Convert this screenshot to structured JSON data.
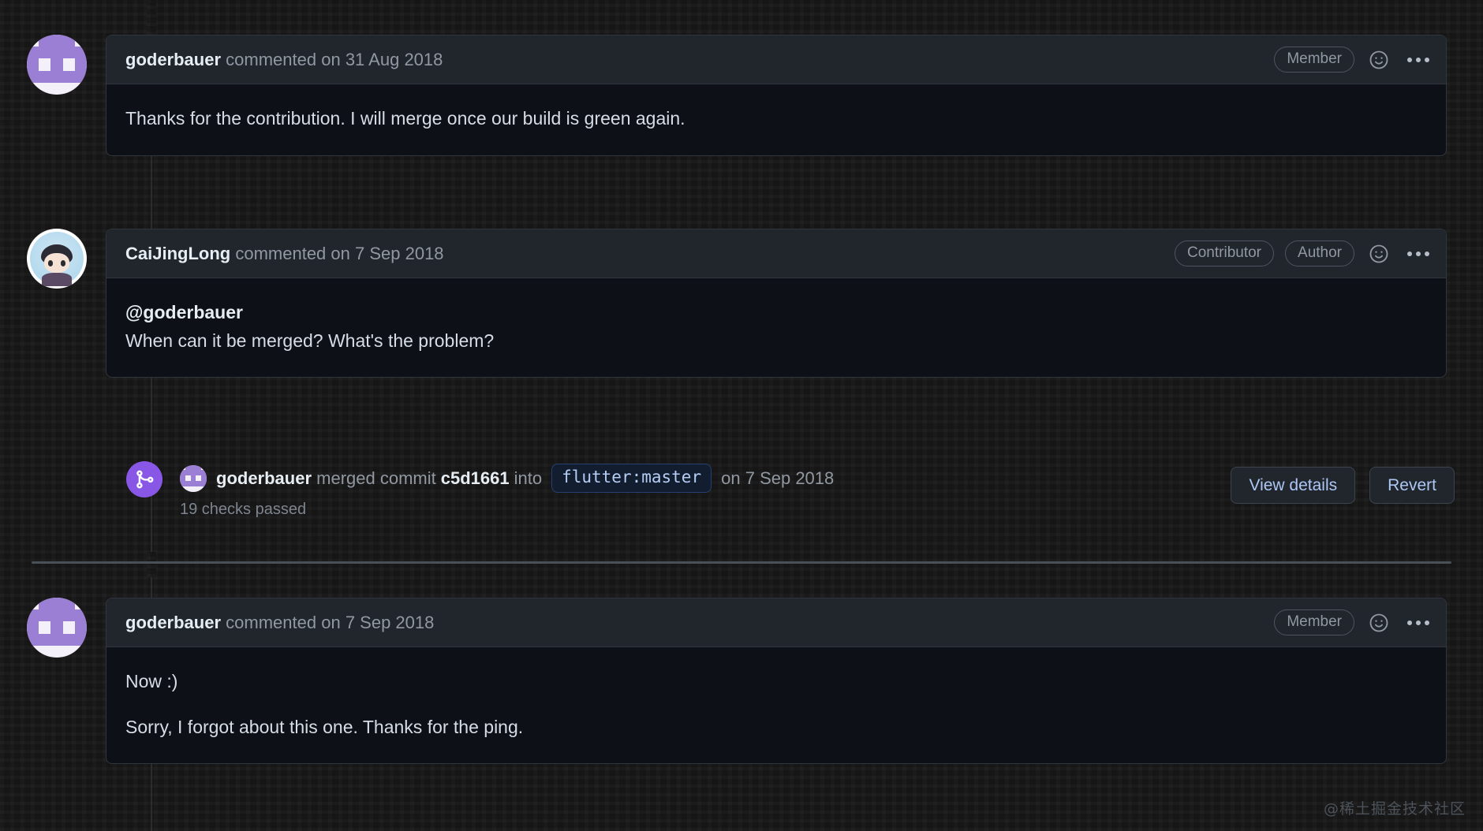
{
  "colors": {
    "page_bg": "#161616",
    "comment_body_bg": "#0d1117",
    "comment_header_bg": "#21262d",
    "border": "#30363d",
    "text_primary": "#e6edf3",
    "text_muted": "#9198a1",
    "accent_purple": "#8957e5",
    "accent_blue": "#acc7f5",
    "branch_chip_bg": "#121d2f",
    "branch_chip_border": "#264070"
  },
  "timeline": [
    {
      "type": "comment",
      "avatar": "identicon-avatar-goderbauer",
      "author": "goderbauer",
      "action": "commented on",
      "timestamp": "31 Aug 2018",
      "badges": [
        "Member"
      ],
      "reaction_icon": "smiley-icon",
      "menu_icon": "kebab-menu-icon",
      "paragraphs": [
        "Thanks for the contribution. I will merge once our build is green again."
      ]
    },
    {
      "type": "comment",
      "avatar": "photo-avatar-caijinglong",
      "author": "CaiJingLong",
      "action": "commented on",
      "timestamp": "7 Sep 2018",
      "badges": [
        "Contributor",
        "Author"
      ],
      "reaction_icon": "smiley-icon",
      "menu_icon": "kebab-menu-icon",
      "mention": "@goderbauer",
      "paragraphs": [
        "When can it be merged? What's the problem?"
      ]
    },
    {
      "type": "merge-event",
      "icon": "git-merge-icon",
      "avatar": "identicon-avatar-goderbauer",
      "actor": "goderbauer",
      "verb": "merged commit",
      "commit_sha": "c5d1661",
      "preposition": "into",
      "branch": "flutter:master",
      "timestamp_prefix": "on",
      "timestamp": "7 Sep 2018",
      "checks_status": "19 checks passed",
      "buttons": [
        "View details",
        "Revert"
      ]
    },
    {
      "type": "comment",
      "avatar": "identicon-avatar-goderbauer",
      "author": "goderbauer",
      "action": "commented on",
      "timestamp": "7 Sep 2018",
      "badges": [
        "Member"
      ],
      "reaction_icon": "smiley-icon",
      "menu_icon": "kebab-menu-icon",
      "paragraphs": [
        "Now :)",
        "Sorry, I forgot about this one. Thanks for the ping."
      ]
    }
  ],
  "watermark": "@稀土掘金技术社区"
}
